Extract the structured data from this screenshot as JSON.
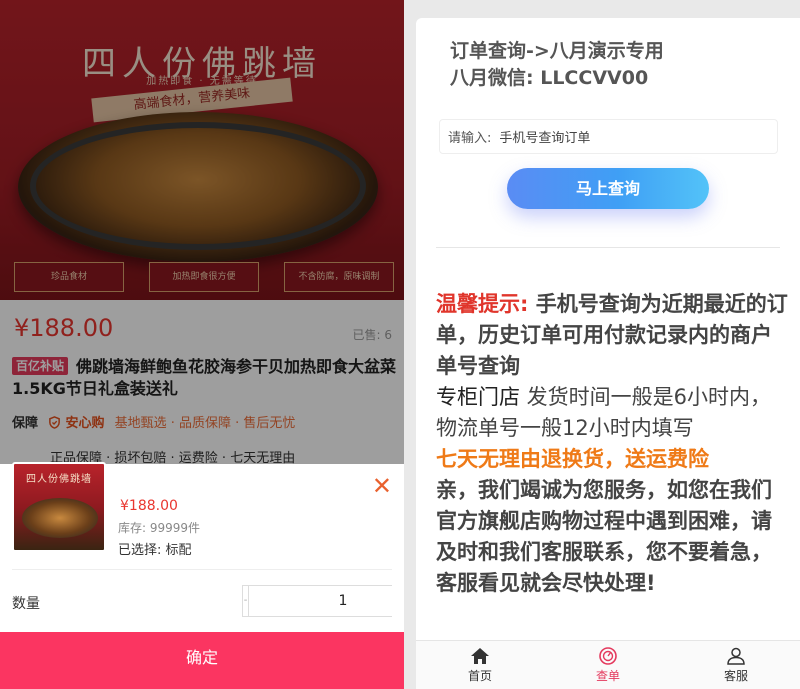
{
  "product": {
    "hero_title": "四人份佛跳墙",
    "hero_subtitle": "加热即食 · 无需等待",
    "hero_ribbon": "高端食材，营养美味",
    "hero_badges": [
      "珍品食材",
      "加热即食很方便",
      "不含防腐，原味调制"
    ],
    "price": "¥188.00",
    "sold": "已售: 6",
    "hot_tag": "百亿补贴",
    "title": "佛跳墙海鲜鲍鱼花胶海参干贝加热即食大盆菜1.5KG节日礼盒装送礼",
    "guarantee_label": "保障",
    "anxin": "安心购",
    "services": "基地甄选 · 品质保障 · 售后无忧",
    "promises": "正品保障 · 损坏包赔 · 运费险 · 七天无理由"
  },
  "sku_sheet": {
    "thumb_title": "四人份佛跳墙",
    "price": "¥188.00",
    "stock": "库存:  99999件",
    "selected": "已选择:  标配",
    "close": "✕",
    "qty_label": "数量",
    "qty_minus": "-",
    "qty_value": "1",
    "confirm": "确定"
  },
  "query": {
    "head_line1": "订单查询->八月演示专用",
    "head_line2": "八月微信:  LLCCVV00",
    "input_label": "请输入:",
    "input_placeholder": "手机号查询订单",
    "button": "马上查询"
  },
  "notice": {
    "tip_label": "温馨提示:",
    "tip_text": " 手机号查询为近期最近的订单，历史订单可用付款记录内的商户单号查询",
    "store": "专柜门店",
    "shipping": " 发货时间一般是6小时内，物流单号一般12小时内填写",
    "return_policy": "七天无理由退换货，送运费险",
    "service_text": "亲，我们竭诚为您服务，如您在我们官方旗舰店购物过程中遇到困难，请及时和我们客服联系，您不要着急，客服看见就会尽快处理!"
  },
  "tabbar": {
    "items": [
      {
        "label": "首页",
        "icon": "home-icon"
      },
      {
        "label": "查单",
        "icon": "query-icon",
        "active": true
      },
      {
        "label": "客服",
        "icon": "user-icon"
      }
    ]
  },
  "colors": {
    "price_red": "#e9362f",
    "confirm_pink": "#fb3561",
    "tip_red": "#e0352b",
    "policy_orange": "#ef7a17",
    "active_tab": "#e4395d"
  }
}
